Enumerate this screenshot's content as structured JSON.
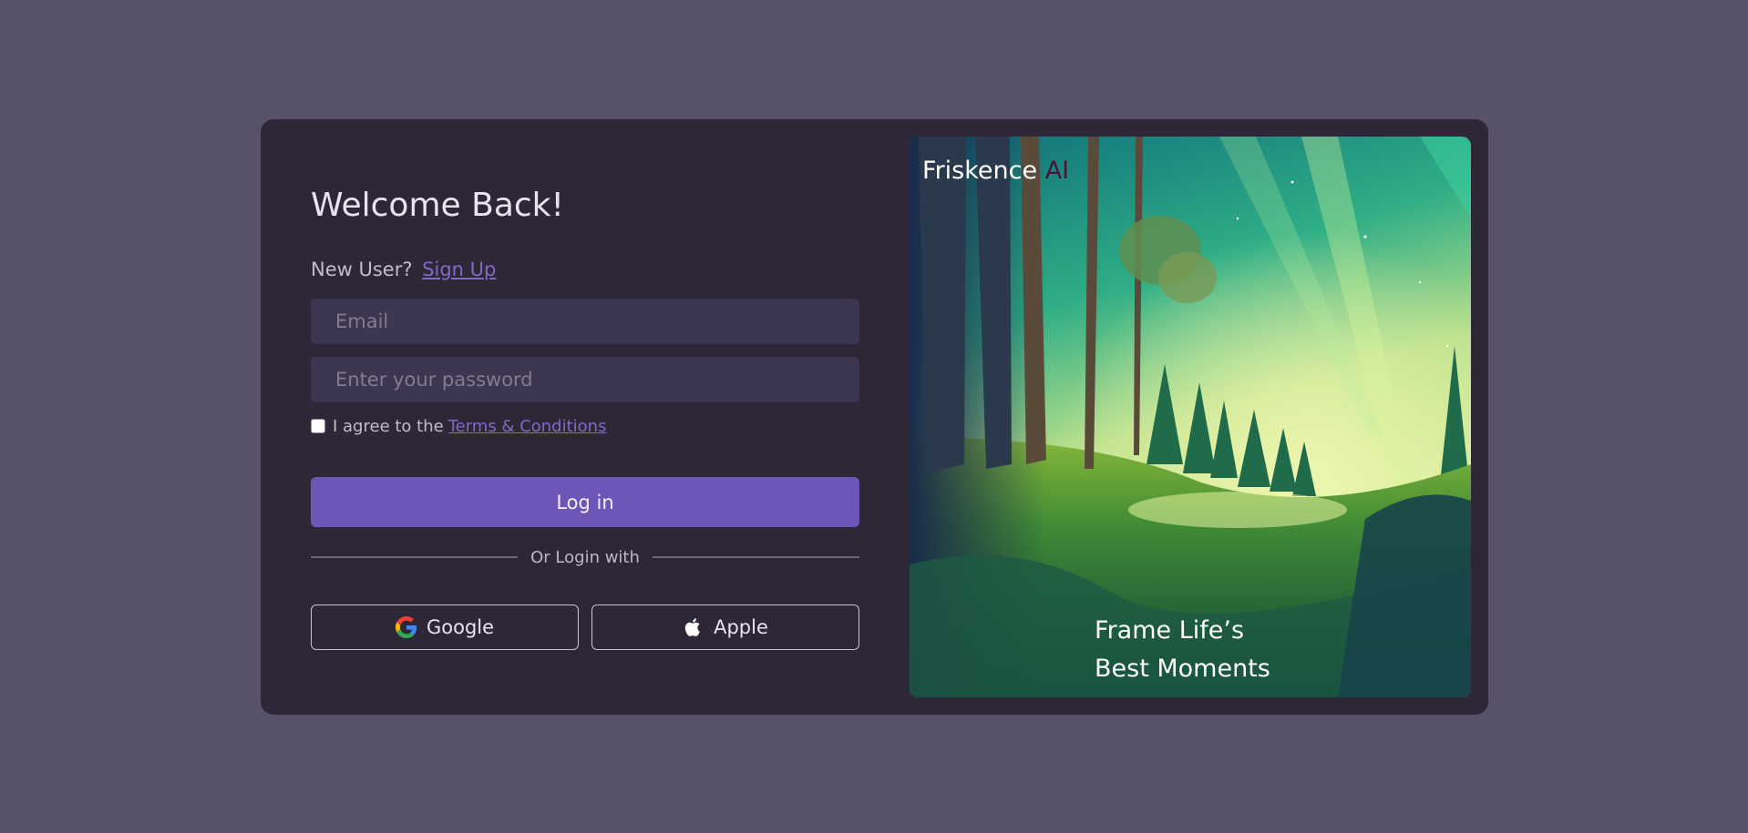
{
  "login": {
    "title": "Welcome Back!",
    "new_user_label": "New User?",
    "sign_up_link": "Sign Up",
    "email_placeholder": "Email",
    "password_placeholder": "Enter your password",
    "agree_text": "I agree to the",
    "terms_link": "Terms & Conditions",
    "login_button": "Log in",
    "divider_text": "Or Login with",
    "google_button": "Google",
    "apple_button": "Apple",
    "google_icon": "google-icon",
    "apple_icon": "apple-icon"
  },
  "hero": {
    "brand_name": "Friskence",
    "brand_suffix": "AI",
    "tagline_line1": "Frame Life’s",
    "tagline_line2": "Best Moments"
  },
  "colors": {
    "page_background": "#585268",
    "card_background": "#2d2738",
    "input_background": "#3c3650",
    "primary": "#6e56b8",
    "link": "#8468c6",
    "brand_accent": "#4a1438"
  }
}
